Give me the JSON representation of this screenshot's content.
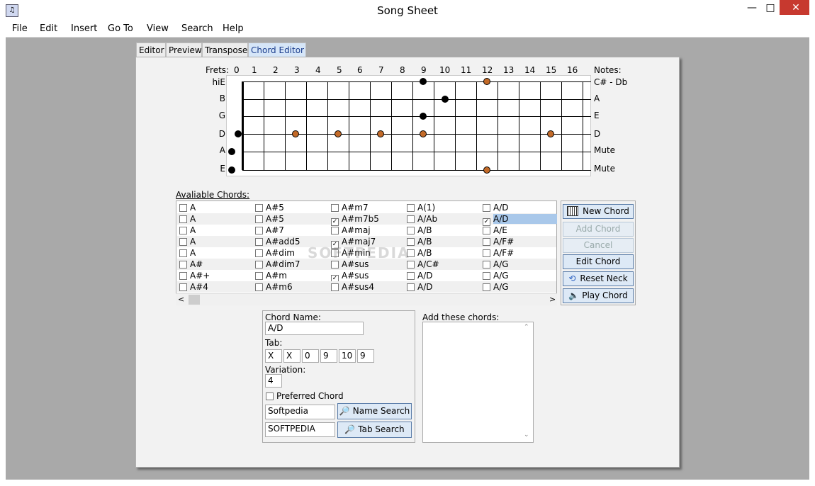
{
  "app": {
    "title": "Song Sheet"
  },
  "window_controls": {
    "minimize": "—",
    "maximize": "□",
    "close": "✕"
  },
  "menu": [
    "File",
    "Edit",
    "Insert",
    "Go To",
    "View",
    "Search",
    "Help"
  ],
  "tabs": [
    "Editor",
    "Preview",
    "Transpose",
    "Chord Editor"
  ],
  "neck": {
    "frets_label": "Frets:",
    "notes_label": "Notes:",
    "fret_numbers": [
      "0",
      "1",
      "2",
      "3",
      "4",
      "5",
      "6",
      "7",
      "8",
      "9",
      "10",
      "11",
      "12",
      "13",
      "14",
      "15",
      "16"
    ],
    "strings": [
      "hiE",
      "B",
      "G",
      "D",
      "A",
      "E"
    ],
    "notes": [
      "C# - Db",
      "A",
      "E",
      "D",
      "Mute",
      "Mute"
    ]
  },
  "available": {
    "label": "Avaliable Chords:",
    "rows": [
      [
        [
          "A",
          false
        ],
        [
          "A#5",
          false
        ],
        [
          "A#m7",
          false
        ],
        [
          "A(1)",
          false
        ],
        [
          "A/D",
          false
        ]
      ],
      [
        [
          "A",
          false
        ],
        [
          "A#5",
          false
        ],
        [
          "A#m7b5",
          true
        ],
        [
          "A/Ab",
          false
        ],
        [
          "A/D",
          true
        ]
      ],
      [
        [
          "A",
          false
        ],
        [
          "A#7",
          false
        ],
        [
          "A#maj",
          false
        ],
        [
          "A/B",
          false
        ],
        [
          "A/E",
          false
        ]
      ],
      [
        [
          "A",
          false
        ],
        [
          "A#add5",
          false
        ],
        [
          "A#maj7",
          true
        ],
        [
          "A/B",
          false
        ],
        [
          "A/F#",
          false
        ]
      ],
      [
        [
          "A",
          false
        ],
        [
          "A#dim",
          false
        ],
        [
          "A#min",
          false
        ],
        [
          "A/B",
          false
        ],
        [
          "A/F#",
          false
        ]
      ],
      [
        [
          "A#",
          false
        ],
        [
          "A#dim7",
          false
        ],
        [
          "A#sus",
          false
        ],
        [
          "A/C#",
          false
        ],
        [
          "A/G",
          false
        ]
      ],
      [
        [
          "A#+",
          false
        ],
        [
          "A#m",
          false
        ],
        [
          "A#sus",
          true
        ],
        [
          "A/D",
          false
        ],
        [
          "A/G",
          false
        ]
      ],
      [
        [
          "A#4",
          false
        ],
        [
          "A#m6",
          false
        ],
        [
          "A#sus4",
          false
        ],
        [
          "A/D",
          false
        ],
        [
          "A/G",
          false
        ]
      ]
    ]
  },
  "buttons": {
    "new_chord": "New Chord",
    "add_chord": "Add Chord",
    "cancel": "Cancel",
    "edit_chord": "Edit Chord",
    "reset_neck": "Reset Neck",
    "play_chord": "Play Chord"
  },
  "form": {
    "chord_name_label": "Chord Name:",
    "chord_name": "A/D",
    "tab_label": "Tab:",
    "tab": [
      "X",
      "X",
      "0",
      "9",
      "10",
      "9"
    ],
    "variation_label": "Variation:",
    "variation": "4",
    "preferred_label": "Preferred Chord",
    "name_search_value": "Softpedia",
    "name_search_btn": "Name Search",
    "tab_search_value": "SOFTPEDIA",
    "tab_search_btn": "Tab Search",
    "add_these_label": "Add these chords:"
  },
  "watermark": "SOFTPEDIA",
  "colors": {
    "accent": "#dde9f6",
    "dot_orange": "#c36a28",
    "selection": "#a9c8ea"
  }
}
